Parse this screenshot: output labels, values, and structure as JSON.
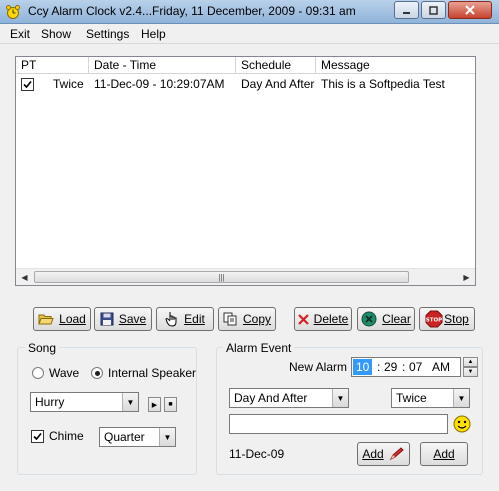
{
  "window": {
    "title": "Ccy Alarm Clock v2.4...Friday, 11 December, 2009 - 09:31 am"
  },
  "menu": {
    "items": [
      "Exit",
      "Show",
      "Settings",
      "Help"
    ]
  },
  "alarm_list": {
    "columns": [
      "PT",
      "Date - Time",
      "Schedule",
      "Message"
    ],
    "rows": [
      {
        "checked": true,
        "repeat": "Twice",
        "datetime": "11-Dec-09 - 10:29:07AM",
        "schedule": "Day And After",
        "message": "This is a Softpedia Test"
      }
    ]
  },
  "toolbar": {
    "load": "Load",
    "save": "Save",
    "edit": "Edit",
    "copy": "Copy",
    "delete": "Delete",
    "clear": "Clear",
    "stop": "Stop"
  },
  "song": {
    "group_label": "Song",
    "wave_label": "Wave",
    "speaker_label": "Internal Speaker",
    "selected_source": "Internal Speaker",
    "song_value": "Hurry",
    "chime_label": "Chime",
    "chime_checked": true,
    "chime_value": "Quarter"
  },
  "alarm_event": {
    "group_label": "Alarm Event",
    "new_alarm_label": "New Alarm :",
    "hour": "10",
    "minute": "29",
    "second": "07",
    "ampm": "AM",
    "schedule_value": "Day And After",
    "repeat_value": "Twice",
    "message_value": "",
    "date_text": "11-Dec-09",
    "add_label_1": "Add",
    "add_label_2": "Add"
  },
  "colors": {
    "title_bar": "#b9d1ea",
    "selected_hour_bg": "#3399ff",
    "close_button": "#c7442f",
    "delete_icon": "#d42020",
    "clear_icon": "#1e8c6a",
    "stop_icon": "#cc2222"
  }
}
